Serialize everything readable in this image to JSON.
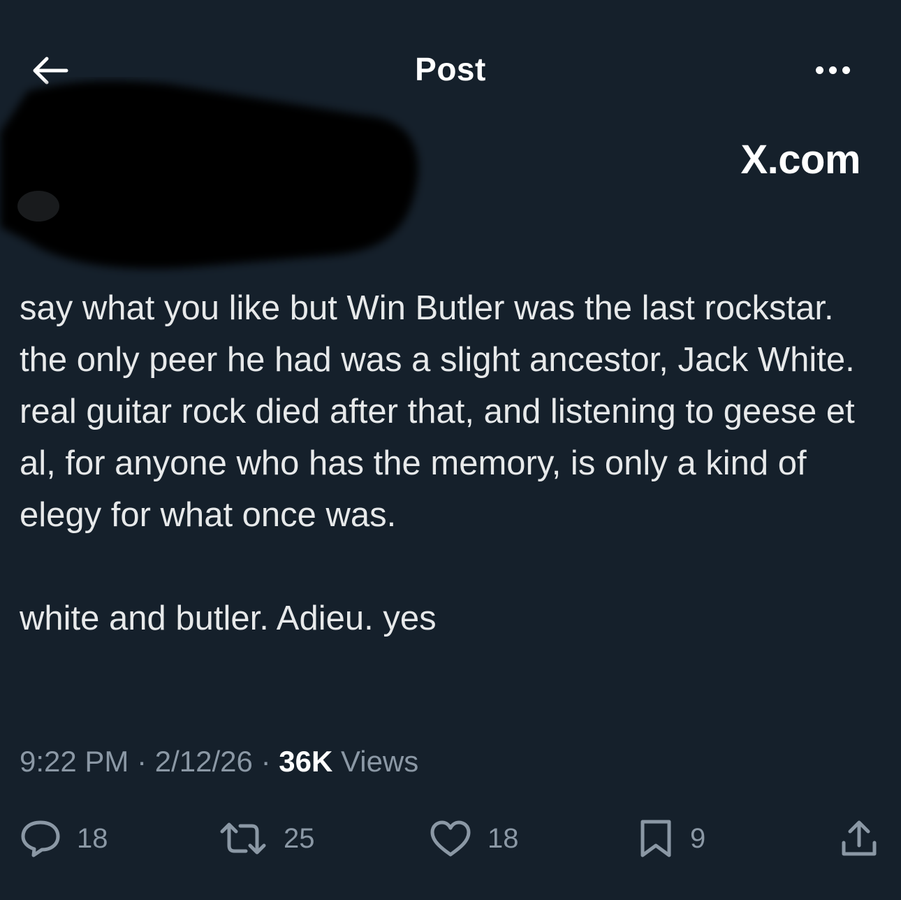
{
  "header": {
    "title": "Post"
  },
  "watermark": "X.com",
  "post": {
    "paragraphs": [
      "say what you like but Win Butler was the last rockstar. the only peer he had was a slight ancestor, Jack White. real guitar rock died after that, and listening to geese et al, for anyone who has the memory, is only a kind of elegy for what once was.",
      "white and butler. Adieu. yes"
    ]
  },
  "meta": {
    "time": "9:22 PM",
    "separator": "·",
    "date": "2/12/26",
    "views_count": "36K",
    "views_label": "Views"
  },
  "actions": {
    "replies": "18",
    "reposts": "25",
    "likes": "18",
    "bookmarks": "9"
  },
  "icons": {
    "back": "arrow-left-icon",
    "more": "more-horizontal-icon",
    "reply": "speech-bubble-icon",
    "repost": "repost-arrows-icon",
    "like": "heart-icon",
    "bookmark": "bookmark-icon",
    "share": "share-upload-icon"
  },
  "colors": {
    "background": "#15202b",
    "text": "#e7e9ea",
    "secondary": "#8b98a5"
  }
}
